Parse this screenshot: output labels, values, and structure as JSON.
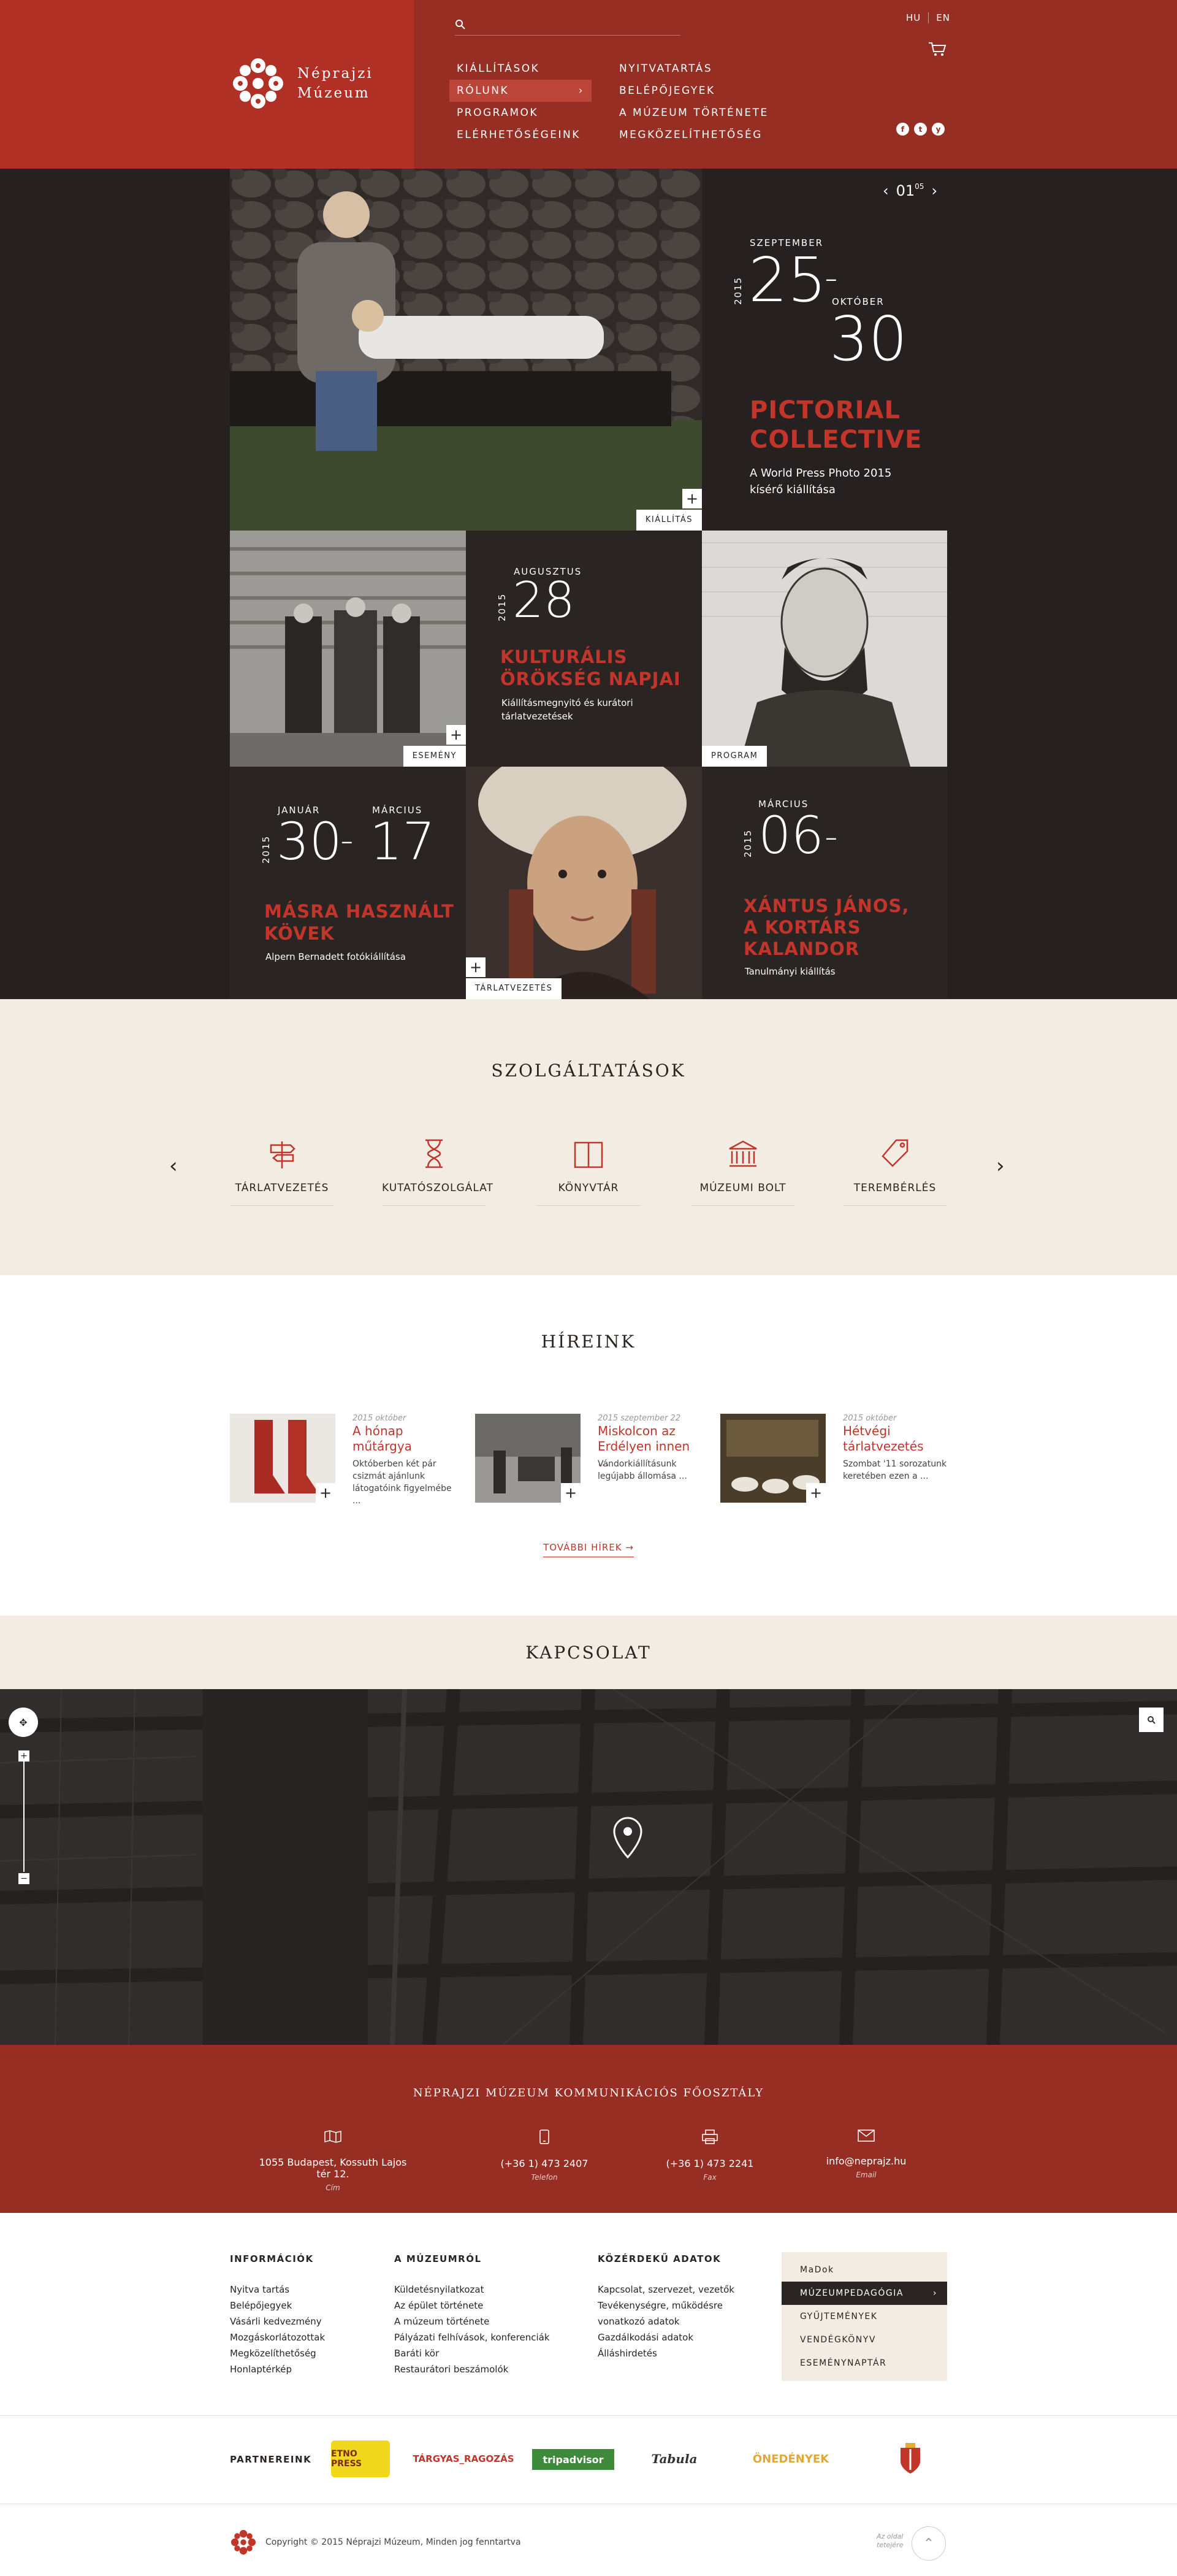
{
  "brand": {
    "name_line1": "Néprajzi",
    "name_line2": "Múzeum"
  },
  "search": {
    "placeholder": ""
  },
  "lang": {
    "hu": "HU",
    "en": "EN"
  },
  "nav": {
    "col1": [
      "KIÁLLÍTÁSOK",
      "RÓLUNK",
      "PROGRAMOK",
      "ELÉRHETŐSÉGEINK"
    ],
    "col2": [
      "NYITVATARTÁS",
      "BELÉPŐJEGYEK",
      "A MÚZEUM TÖRTÉNETE",
      "MEGKÖZELÍTHETŐSÉG"
    ],
    "active": "RÓLUNK"
  },
  "social": [
    "f",
    "t",
    "y"
  ],
  "slider": {
    "current": "01",
    "total": "05"
  },
  "featured": {
    "main": {
      "month1": "SZEPTEMBER",
      "day1": "25",
      "month2": "OKTÓBER",
      "day2": "30",
      "year": "2015",
      "title_l1": "PICTORIAL",
      "title_l2": "COLLECTIVE",
      "sub_l1": "A World Press Photo 2015",
      "sub_l2": "kísérő kiállítása",
      "badge": "KIÁLLÍTÁS"
    },
    "event": {
      "badge": "ESEMÉNY",
      "month": "AUGUSZTUS",
      "day": "28",
      "year": "2015",
      "title_l1": "KULTURÁLIS",
      "title_l2": "ÖRÖKSÉG NAPJAI",
      "sub_l1": "Kiállításmegnyitó és kurátori",
      "sub_l2": "tárlatvezetések"
    },
    "program": {
      "badge": "PROGRAM"
    },
    "stones": {
      "month1": "JANUÁR",
      "day1": "30",
      "month2": "MÁRCIUS",
      "day2": "17",
      "year": "2015",
      "title_l1": "MÁSRA HASZNÁLT",
      "title_l2": "KÖVEK",
      "sub": "Alpern Bernadett fotókiállítása"
    },
    "tour": {
      "badge": "TÁRLATVEZETÉS"
    },
    "xantus": {
      "month": "MÁRCIUS",
      "day": "06",
      "year": "2015",
      "title_l1": "XÁNTUS JÁNOS,",
      "title_l2": "A KORTÁRS",
      "title_l3": "KALANDOR",
      "sub": "Tanulmányi kiállítás"
    }
  },
  "services": {
    "title": "SZOLGÁLTATÁSOK",
    "items": [
      {
        "label": "TÁRLATVEZETÉS",
        "icon": "signpost-icon"
      },
      {
        "label": "KUTATÓSZOLGÁLAT",
        "icon": "hourglass-icon"
      },
      {
        "label": "KÖNYVTÁR",
        "icon": "book-icon"
      },
      {
        "label": "MÚZEUMI BOLT",
        "icon": "museum-icon"
      },
      {
        "label": "TEREMBÉRLÉS",
        "icon": "tag-icon"
      }
    ]
  },
  "news": {
    "title": "HÍREINK",
    "more": "TOVÁBBI HÍREK →",
    "items": [
      {
        "date": "2015 október",
        "title": "A hónap műtárgya",
        "text": "Októberben két pár csizmát ajánlunk látogatóink figyelmébe ..."
      },
      {
        "date": "2015 szeptember 22",
        "title": "Miskolcon az Erdélyen innen ...",
        "text": "Vándorkiállításunk legújabb állomása ..."
      },
      {
        "date": "2015 október",
        "title": "Hétvégi tárlatvezetés",
        "text": "Szombat '11 sorozatunk keretében ezen a ..."
      }
    ]
  },
  "contact": {
    "title": "KAPCSOLAT"
  },
  "comm": {
    "title": "NÉPRAJZI MÚZEUM KOMMUNIKÁCIÓS FŐOSZTÁLY",
    "items": [
      {
        "value": "1055 Budapest, Kossuth Lajos tér 12.",
        "key": "Cím"
      },
      {
        "value": "(+36 1) 473 2407",
        "key": "Telefon"
      },
      {
        "value": "(+36 1) 473 2241",
        "key": "Fax"
      },
      {
        "value": "info@neprajz.hu",
        "key": "Email"
      }
    ]
  },
  "footer": {
    "col1": {
      "title": "INFORMÁCIÓK",
      "items": [
        "Nyitva tartás",
        "Belépőjegyek",
        "Vásárli kedvezmény",
        "Mozgáskorlátozottak",
        "Megközelíthetőség",
        "Honlaptérkép"
      ]
    },
    "col2": {
      "title": "A MÚZEUMRÓL",
      "items": [
        "Küldetésnyilatkozat",
        "Az épület története",
        "A múzeum története",
        "Pályázati felhívások, konferenciák",
        "Baráti kör",
        "Restaurátori beszámolók"
      ]
    },
    "col3": {
      "title": "KÖZÉRDEKŰ ADATOK",
      "items": [
        "Kapcsolat, szervezet, vezetők",
        "Tevékenységre, működésre vonatkozó adatok",
        "Gazdálkodási adatok",
        "Álláshirdetés"
      ]
    },
    "menu": [
      "MaDok",
      "MÚZEUMPEDAGÓGIA",
      "GYŰJTEMÉNYEK",
      "VENDÉGKÖNYV",
      "ESEMÉNYNAPTÁR"
    ]
  },
  "partners": {
    "title": "PARTNEREINK",
    "items": [
      "ETNO PRESS",
      "TÁRGYAS_RAGOZÁS",
      "tripadvisor",
      "Tabula",
      "ÖNEDÉNYEK"
    ]
  },
  "copyright": "Copyright © 2015 Néprajzi Múzeum, Minden jog fenntartva",
  "totop": {
    "l1": "Az oldal",
    "l2": "tetejére"
  },
  "colors": {
    "red": "#b03026",
    "darkred": "#962e23",
    "dark": "#262020",
    "beige": "#f2ece3",
    "accent": "#c2352b"
  }
}
